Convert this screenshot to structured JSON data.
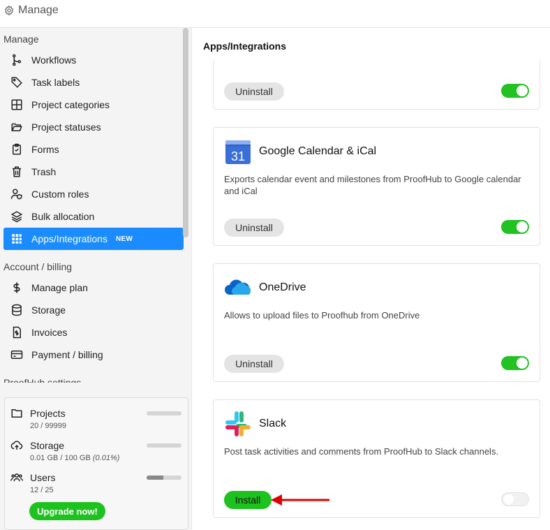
{
  "header": {
    "title": "Manage",
    "icon": "gear-icon"
  },
  "sidebar": {
    "manage_title": "Manage",
    "items": [
      {
        "label": "Workflows",
        "icon": "workflow-icon"
      },
      {
        "label": "Task labels",
        "icon": "tag-icon"
      },
      {
        "label": "Project categories",
        "icon": "grid-icon"
      },
      {
        "label": "Project statuses",
        "icon": "folder-open-icon"
      },
      {
        "label": "Forms",
        "icon": "clipboard-icon"
      },
      {
        "label": "Trash",
        "icon": "trash-icon"
      },
      {
        "label": "Custom roles",
        "icon": "user-shield-icon"
      },
      {
        "label": "Bulk allocation",
        "icon": "layers-icon"
      },
      {
        "label": "Apps/Integrations",
        "icon": "apps-icon",
        "badge": "NEW",
        "active": true
      }
    ],
    "billing_title": "Account / billing",
    "billing_items": [
      {
        "label": "Manage plan",
        "icon": "dollar-icon"
      },
      {
        "label": "Storage",
        "icon": "database-icon"
      },
      {
        "label": "Invoices",
        "icon": "invoice-icon"
      },
      {
        "label": "Payment / billing",
        "icon": "credit-card-icon"
      }
    ],
    "settings_title": "ProofHub settings"
  },
  "usage": {
    "projects": {
      "label": "Projects",
      "value": "20 / 99999",
      "fraction": 0.0002
    },
    "storage": {
      "label": "Storage",
      "value_prefix": "0.01 GB / 100 GB ",
      "value_pct": "(0.01%)",
      "fraction": 0.0001
    },
    "users": {
      "label": "Users",
      "value": "12 / 25",
      "fraction": 0.48
    },
    "upgrade_label": "Upgrade now!"
  },
  "main": {
    "title": "Apps/Integrations",
    "cards": [
      {
        "name": "",
        "description": "",
        "action": "Uninstall",
        "enabled": true
      },
      {
        "name": "Google Calendar & iCal",
        "description": "Exports calendar event and milestones from ProofHub to Google calendar and iCal",
        "action": "Uninstall",
        "enabled": true,
        "logo": "google-calendar-icon",
        "logo_text": "31"
      },
      {
        "name": "OneDrive",
        "description": "Allows to upload files to Proofhub from OneDrive",
        "action": "Uninstall",
        "enabled": true,
        "logo": "onedrive-icon"
      },
      {
        "name": "Slack",
        "description": "Post task activities and comments from ProofHub to Slack channels.",
        "action": "Install",
        "enabled": false,
        "logo": "slack-icon"
      }
    ]
  },
  "colors": {
    "accent": "#1a8cff",
    "green": "#1ec21e",
    "arrow": "#e00000"
  }
}
